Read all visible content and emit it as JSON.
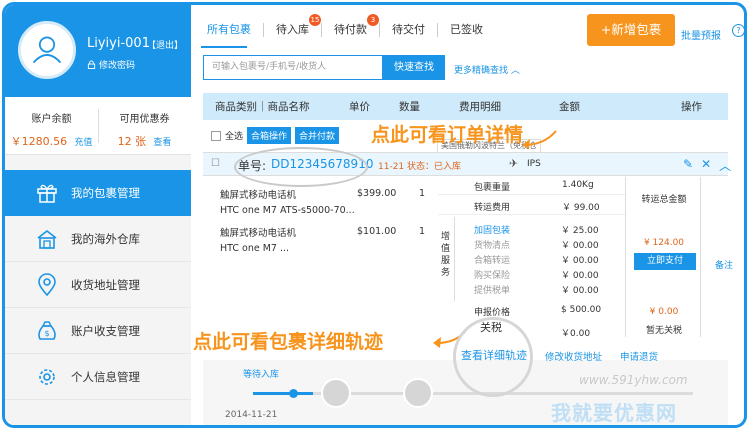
{
  "colors": {
    "accent": "#1a94e6",
    "orange": "#f7941d",
    "price": "#e0641c",
    "badge": "#f05a24"
  },
  "user": {
    "name": "Liyiyi-001",
    "logout": "【退出】",
    "change_password": "修改密码"
  },
  "balances": {
    "left": {
      "title": "账户余额",
      "value": "￥1280.56",
      "link": "充值"
    },
    "right": {
      "title": "可用优惠券",
      "value": "12 张",
      "link": "查看"
    }
  },
  "nav": [
    {
      "label": "我的包裹管理",
      "icon": "gift-box-icon",
      "active": true
    },
    {
      "label": "我的海外仓库",
      "icon": "warehouse-icon",
      "active": false
    },
    {
      "label": "收货地址管理",
      "icon": "location-pin-icon",
      "active": false
    },
    {
      "label": "账户收支管理",
      "icon": "money-bag-icon",
      "active": false
    },
    {
      "label": "个人信息管理",
      "icon": "settings-gear-icon",
      "active": false
    }
  ],
  "tabs": [
    {
      "label": "所有包裹",
      "active": true,
      "badge": ""
    },
    {
      "label": "待入库",
      "active": false,
      "badge": "15"
    },
    {
      "label": "待付款",
      "active": false,
      "badge": "3"
    },
    {
      "label": "待交付",
      "active": false,
      "badge": ""
    },
    {
      "label": "已签收",
      "active": false,
      "badge": ""
    }
  ],
  "actions": {
    "add_package": "+新增包裹",
    "batch_forecast": "批量预报",
    "help": "?"
  },
  "search": {
    "placeholder": "可输入包裹号/手机号/收货人",
    "button": "快速查找",
    "advanced": "更多精确查找 ︿"
  },
  "table_header": {
    "category": "商品类别｜商品名称",
    "unit_price": "单价",
    "quantity": "数量",
    "fee_detail": "费用明细",
    "amount": "金额",
    "operation": "操作"
  },
  "toolbar": {
    "select_all": "全选",
    "merge": "合箱操作",
    "merge_pay": "合并付款"
  },
  "callouts": {
    "order_detail": "点此可看订单详情",
    "track_detail": "点此可看包裹详细轨迹"
  },
  "tooltip": "美国俄勒冈波特兰（免税仓库）",
  "order": {
    "number_label": "单号:",
    "number": "DD12345678910",
    "meta": "11-21  状态：已入库",
    "carrier": "IPS",
    "items": [
      {
        "line1": "触屏式移动电话机",
        "line2": "HTC one M7 ATS-s5000-70...",
        "price": "$399.00",
        "qty": "1"
      },
      {
        "line1": "触屏式移动电话机",
        "line2": "HTC one M7 ...",
        "price": "$101.00",
        "qty": "1"
      }
    ]
  },
  "fees": {
    "weight_label": "包裹重量",
    "weight": "1.40Kg",
    "shipping_label": "转运费用",
    "shipping": "￥ 99.00",
    "added_service_label": "增值服务",
    "services": [
      {
        "label": "加固包装",
        "value": "￥ 25.00",
        "link": true
      },
      {
        "label": "货物清点",
        "value": "￥ 00.00",
        "link": false
      },
      {
        "label": "合箱转运",
        "value": "￥ 00.00",
        "link": false
      },
      {
        "label": "购买保险",
        "value": "￥ 00.00",
        "link": false
      },
      {
        "label": "提供税单",
        "value": "￥ 00.00",
        "link": false
      }
    ],
    "declared_label": "申报价格",
    "declared": "$ 500.00",
    "tax_label": "关税",
    "tax": "￥0.00"
  },
  "totals": {
    "label": "转运总金额",
    "amount": "¥ 124.00",
    "pay_button": "立即支付",
    "tax_amount": "¥ 0.00",
    "tax_none": "暂无关税",
    "note": "备注"
  },
  "links": {
    "track": "查看详细轨迹",
    "edit_address": "修改收货地址",
    "refund": "申请退货"
  },
  "timeline": {
    "label": "等待入库",
    "date": "2014-11-21"
  },
  "watermark": {
    "url": "www.591yhw.com",
    "name": "我就要优惠网"
  }
}
